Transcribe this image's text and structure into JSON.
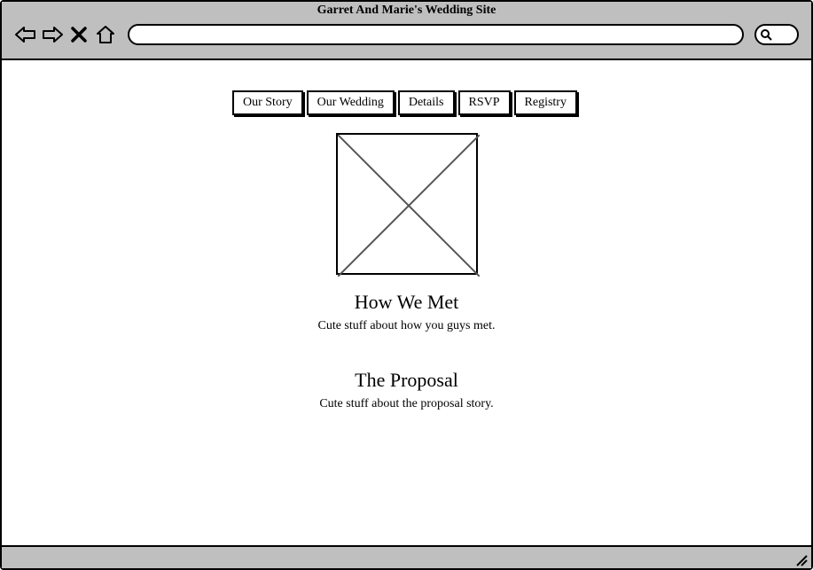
{
  "browser": {
    "title": "Garret And Marie's Wedding Site"
  },
  "nav": {
    "items": [
      {
        "label": "Our Story"
      },
      {
        "label": "Our Wedding"
      },
      {
        "label": "Details"
      },
      {
        "label": "RSVP"
      },
      {
        "label": "Registry"
      }
    ]
  },
  "sections": [
    {
      "title": "How We Met",
      "body": "Cute stuff about how you guys met."
    },
    {
      "title": "The Proposal",
      "body": "Cute stuff about the proposal story."
    }
  ]
}
